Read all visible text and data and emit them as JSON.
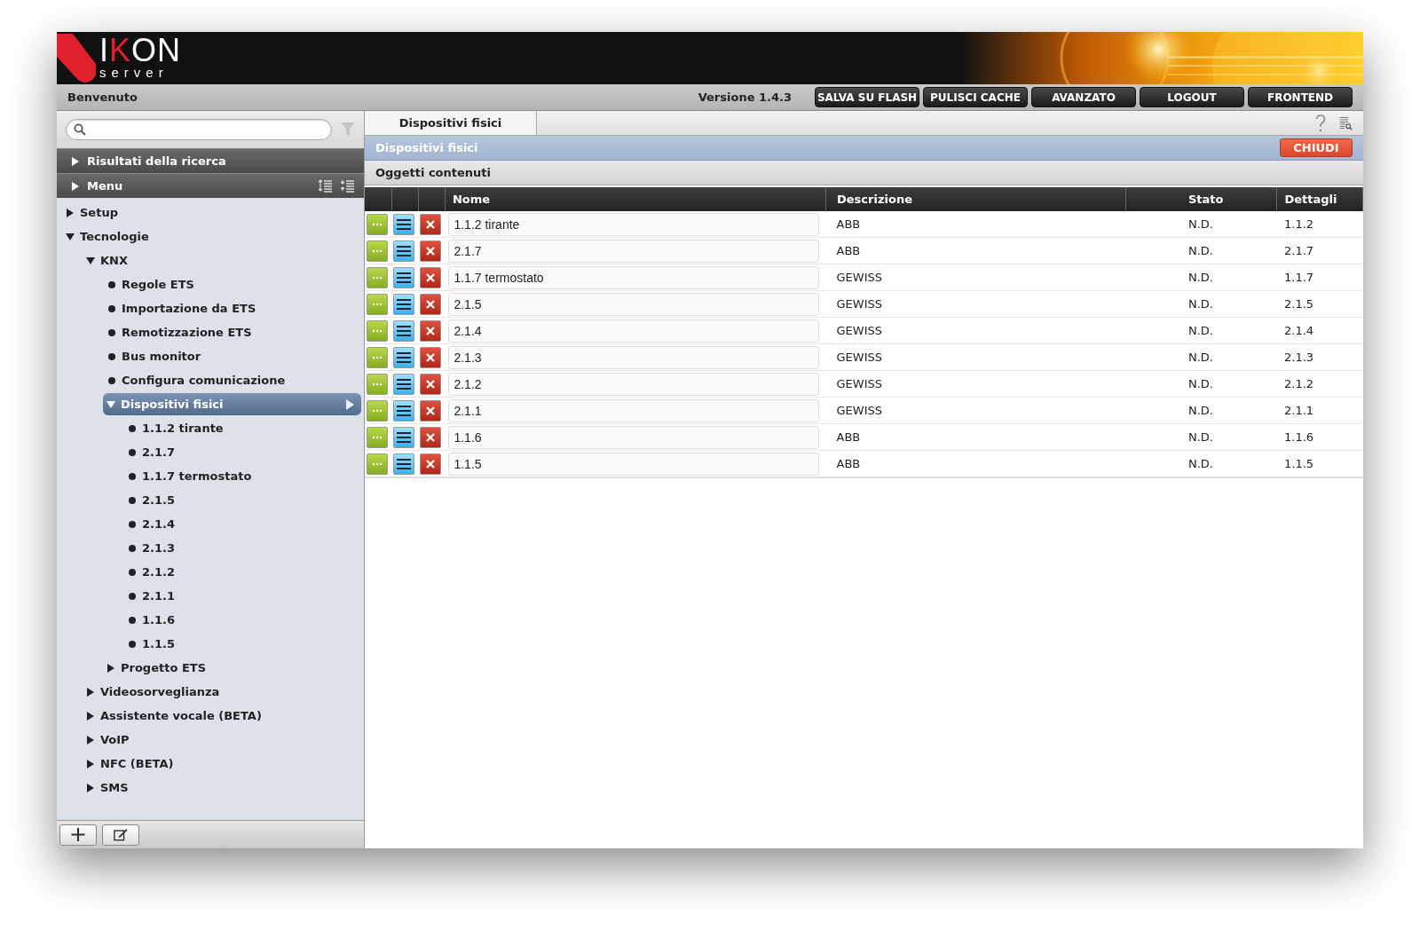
{
  "header": {
    "logo": "IKON",
    "logo_sub": "server"
  },
  "toolbar": {
    "welcome": "Benvenuto",
    "version": "Versione 1.4.3",
    "buttons": [
      "SALVA SU FLASH",
      "PULISCI CACHE",
      "AVANZATO",
      "LOGOUT",
      "FRONTEND"
    ]
  },
  "sidebar": {
    "sections": [
      {
        "label": "Risultati della ricerca",
        "expanded": false
      },
      {
        "label": "Menu",
        "expanded": false
      }
    ],
    "tree": [
      {
        "label": "Setup",
        "kind": "branch",
        "expanded": false,
        "selected": false
      },
      {
        "label": "Tecnologie",
        "kind": "branch",
        "expanded": true,
        "selected": false,
        "children": [
          {
            "label": "KNX",
            "kind": "branch",
            "expanded": true,
            "selected": false,
            "children": [
              {
                "label": "Regole ETS",
                "kind": "leaf",
                "selected": false
              },
              {
                "label": "Importazione da ETS",
                "kind": "leaf",
                "selected": false
              },
              {
                "label": "Remotizzazione ETS",
                "kind": "leaf",
                "selected": false
              },
              {
                "label": "Bus monitor",
                "kind": "leaf",
                "selected": false
              },
              {
                "label": "Configura comunicazione",
                "kind": "leaf",
                "selected": false
              },
              {
                "label": "Dispositivi fisici",
                "kind": "branch",
                "expanded": true,
                "selected": true,
                "children": [
                  {
                    "label": "1.1.2 tirante",
                    "kind": "leaf",
                    "selected": false
                  },
                  {
                    "label": "2.1.7",
                    "kind": "leaf",
                    "selected": false
                  },
                  {
                    "label": "1.1.7 termostato",
                    "kind": "leaf",
                    "selected": false
                  },
                  {
                    "label": "2.1.5",
                    "kind": "leaf",
                    "selected": false
                  },
                  {
                    "label": "2.1.4",
                    "kind": "leaf",
                    "selected": false
                  },
                  {
                    "label": "2.1.3",
                    "kind": "leaf",
                    "selected": false
                  },
                  {
                    "label": "2.1.2",
                    "kind": "leaf",
                    "selected": false
                  },
                  {
                    "label": "2.1.1",
                    "kind": "leaf",
                    "selected": false
                  },
                  {
                    "label": "1.1.6",
                    "kind": "leaf",
                    "selected": false
                  },
                  {
                    "label": "1.1.5",
                    "kind": "leaf",
                    "selected": false
                  }
                ]
              },
              {
                "label": "Progetto ETS",
                "kind": "branch",
                "expanded": false,
                "selected": false
              }
            ]
          },
          {
            "label": "Videosorveglianza",
            "kind": "branch",
            "expanded": false,
            "selected": false
          },
          {
            "label": "Assistente vocale (BETA)",
            "kind": "branch",
            "expanded": false,
            "selected": false
          },
          {
            "label": "VoIP",
            "kind": "branch",
            "expanded": false,
            "selected": false
          },
          {
            "label": "NFC (BETA)",
            "kind": "branch",
            "expanded": false,
            "selected": false
          },
          {
            "label": "SMS",
            "kind": "branch",
            "expanded": false,
            "selected": false
          }
        ]
      }
    ]
  },
  "tabs": [
    {
      "label": "Dispositivi fisici",
      "selected": true
    }
  ],
  "panel": {
    "title": "Dispositivi fisici",
    "close": "CHIUDI",
    "subtitle": "Oggetti contenuti"
  },
  "table": {
    "columns": [
      "Nome",
      "Descrizione",
      "Stato",
      "Dettagli"
    ],
    "rows": [
      {
        "name": "1.1.2 tirante",
        "description": "ABB",
        "state": "N.D.",
        "details": "1.1.2"
      },
      {
        "name": "2.1.7",
        "description": "ABB",
        "state": "N.D.",
        "details": "2.1.7"
      },
      {
        "name": "1.1.7 termostato",
        "description": "GEWISS",
        "state": "N.D.",
        "details": "1.1.7"
      },
      {
        "name": "2.1.5",
        "description": "GEWISS",
        "state": "N.D.",
        "details": "2.1.5"
      },
      {
        "name": "2.1.4",
        "description": "GEWISS",
        "state": "N.D.",
        "details": "2.1.4"
      },
      {
        "name": "2.1.3",
        "description": "GEWISS",
        "state": "N.D.",
        "details": "2.1.3"
      },
      {
        "name": "2.1.2",
        "description": "GEWISS",
        "state": "N.D.",
        "details": "2.1.2"
      },
      {
        "name": "2.1.1",
        "description": "GEWISS",
        "state": "N.D.",
        "details": "2.1.1"
      },
      {
        "name": "1.1.6",
        "description": "ABB",
        "state": "N.D.",
        "details": "1.1.6"
      },
      {
        "name": "1.1.5",
        "description": "ABB",
        "state": "N.D.",
        "details": "1.1.5"
      }
    ]
  }
}
